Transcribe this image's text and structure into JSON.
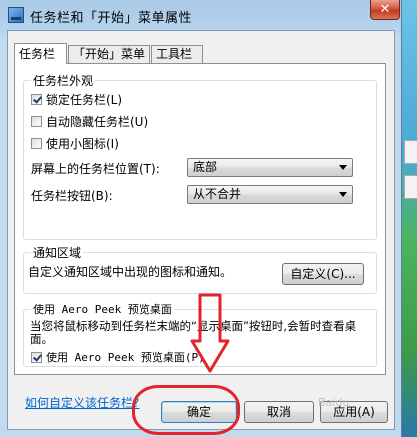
{
  "window": {
    "title": "任务栏和「开始」菜单属性",
    "close_label": "✕"
  },
  "tabs": [
    {
      "label": "任务栏",
      "active": true
    },
    {
      "label": "「开始」菜单",
      "active": false
    },
    {
      "label": "工具栏",
      "active": false
    }
  ],
  "appearance": {
    "title": "任务栏外观",
    "lock_taskbar": {
      "label": "锁定任务栏(L)",
      "checked": true
    },
    "auto_hide": {
      "label": "自动隐藏任务栏(U)",
      "checked": false
    },
    "small_icons": {
      "label": "使用小图标(I)",
      "checked": false
    },
    "position_label": "屏幕上的任务栏位置(T):",
    "position_value": "底部",
    "buttons_label": "任务栏按钮(B):",
    "buttons_value": "从不合并"
  },
  "notification": {
    "title": "通知区域",
    "description": "自定义通知区域中出现的图标和通知。",
    "customize_button": "自定义(C)..."
  },
  "aero_peek": {
    "title": "使用 Aero Peek 预览桌面",
    "description": "当您将鼠标移动到任务栏末端的“显示桌面”按钮时,会暂时查看桌面。",
    "checkbox": {
      "label": "使用 Aero Peek 预览桌面(P)",
      "checked": true
    }
  },
  "link": "如何自定义该任务栏?",
  "footer": {
    "ok": "确定",
    "cancel": "取消",
    "apply": "应用(A)"
  },
  "watermark": "Baidu",
  "colors": {
    "annotation": "#e2252a",
    "link": "#0066cc"
  }
}
